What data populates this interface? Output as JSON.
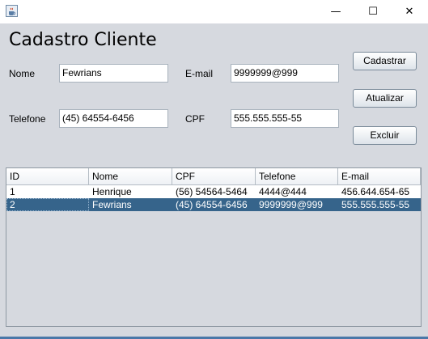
{
  "window": {
    "minimize_glyph": "—",
    "maximize_glyph": "☐",
    "close_glyph": "✕"
  },
  "form": {
    "title": "Cadastro Cliente",
    "nome_label": "Nome",
    "nome_value": "Fewrians",
    "email_label": "E-mail",
    "email_value": "9999999@999",
    "telefone_label": "Telefone",
    "telefone_value": "(45) 64554-6456",
    "cpf_label": "CPF",
    "cpf_value": "555.555.555-55"
  },
  "buttons": {
    "cadastrar": "Cadastrar",
    "atualizar": "Atualizar",
    "excluir": "Excluir"
  },
  "table": {
    "columns": [
      "ID",
      "Nome",
      "CPF",
      "Telefone",
      "E-mail"
    ],
    "rows": [
      [
        "1",
        "Henrique",
        "(56) 54564-5464",
        "4444@444",
        "456.644.654-65"
      ],
      [
        "2",
        "Fewrians",
        "(45) 64554-6456",
        "9999999@999",
        "555.555.555-55"
      ]
    ],
    "selected_row": 1
  },
  "colors": {
    "selection": "#36648b",
    "background": "#d6d9df"
  },
  "icons": {
    "app": "java-cup-icon"
  }
}
